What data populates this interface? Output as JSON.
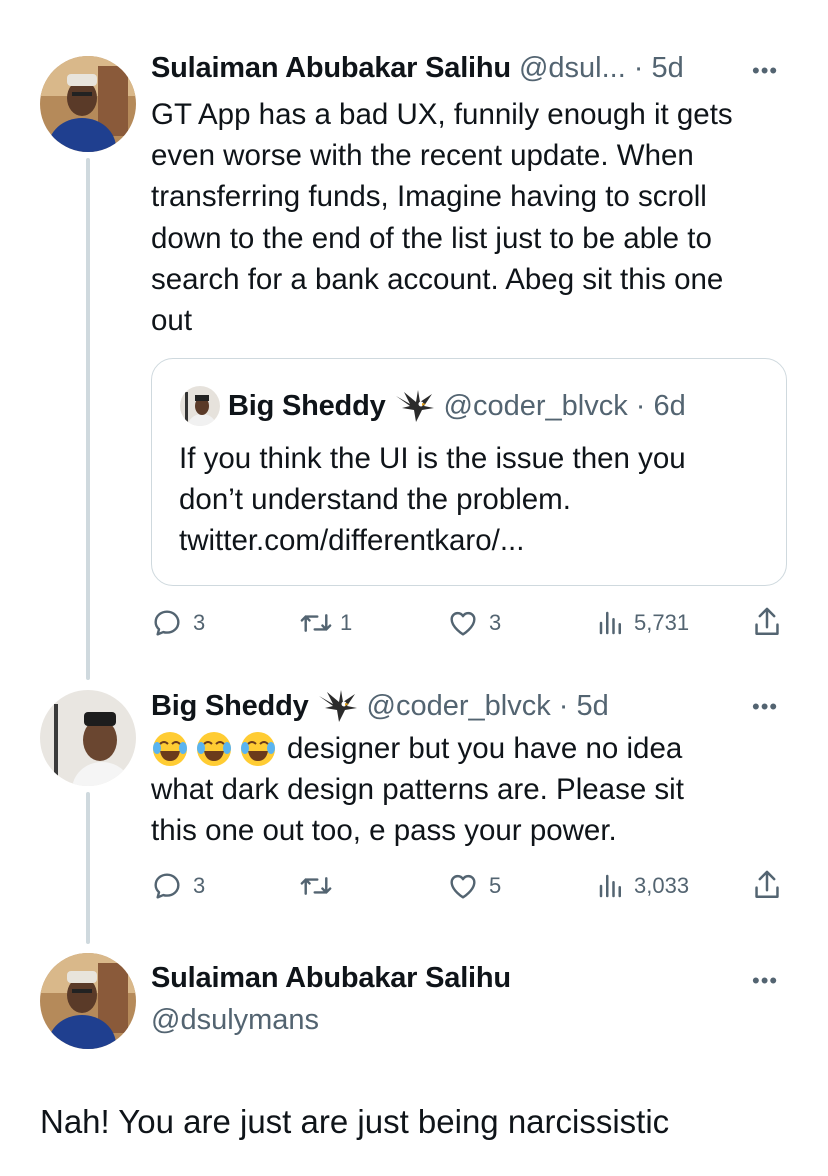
{
  "tweet1": {
    "name": "Sulaiman Abubakar Salihu",
    "handle_time": "@dsul... · 5d",
    "lines": [
      "GT App has a bad UX,  funnily enough it gets",
      "even worse with the recent update. When",
      "transferring funds, Imagine having to scroll",
      "down to the end of the list just to be able to",
      "search for a bank account. Abeg sit this one",
      "out"
    ],
    "quote": {
      "name": "Big Sheddy",
      "handle_time": "@coder_blvck · 6d",
      "lines": [
        "If you think the UI is the issue then you",
        "don’t understand the problem.",
        "twitter.com/differentkaro/..."
      ]
    },
    "actions": {
      "replies": "3",
      "retweets": "1",
      "likes": "3",
      "views": "5,731"
    }
  },
  "tweet2": {
    "name": "Big Sheddy",
    "handle_time": "@coder_blvck · 5d",
    "first_line_text": "designer but you have no idea",
    "emoji": "😂😂😂",
    "lines": [
      "what dark design patterns are. Please sit",
      "this one out too, e pass your power."
    ],
    "actions": {
      "replies": "3",
      "retweets": "",
      "likes": "5",
      "views": "3,033"
    }
  },
  "tweet3": {
    "name": "Sulaiman Abubakar Salihu",
    "handle": "@dsulymans",
    "text": "Nah! You are just are just being narcissistic"
  },
  "more_glyph": "•••",
  "colors": {
    "text": "#0f1419",
    "secondary": "#536471",
    "border": "#cfd9de"
  }
}
